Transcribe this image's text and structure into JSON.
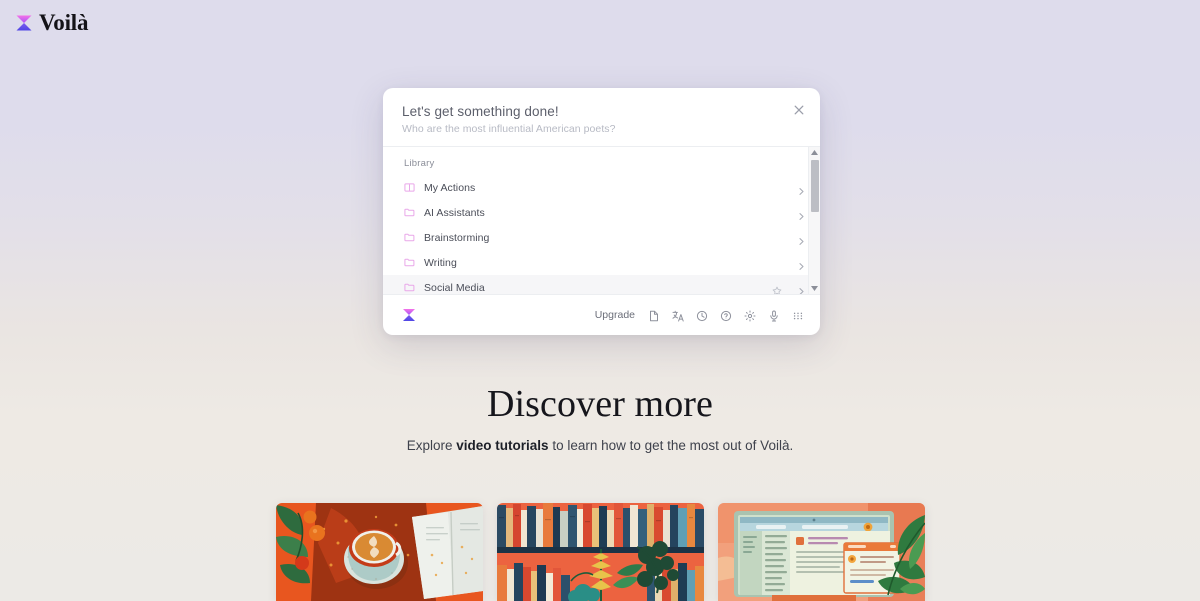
{
  "brand": {
    "name": "Voilà",
    "logo_icon": "hourglass-icon"
  },
  "modal": {
    "title": "Let's get something done!",
    "search_placeholder": "Who are the most influential American poets?",
    "close_icon": "close-icon",
    "section_label": "Library",
    "items": [
      {
        "label": "My Actions",
        "icon": "book-icon",
        "chevron": "chevron-right-icon",
        "starred": false,
        "selected": false
      },
      {
        "label": "AI Assistants",
        "icon": "folder-icon",
        "chevron": "chevron-right-icon",
        "starred": false,
        "selected": false
      },
      {
        "label": "Brainstorming",
        "icon": "folder-icon",
        "chevron": "chevron-right-icon",
        "starred": false,
        "selected": false
      },
      {
        "label": "Writing",
        "icon": "folder-icon",
        "chevron": "chevron-right-icon",
        "starred": false,
        "selected": false
      },
      {
        "label": "Social Media",
        "icon": "folder-icon",
        "chevron": "chevron-right-icon",
        "starred": true,
        "selected": true
      }
    ],
    "scrollbar": {
      "up_icon": "scroll-up-arrow",
      "down_icon": "scroll-down-arrow"
    },
    "footer": {
      "logo_icon": "hourglass-icon",
      "upgrade_label": "Upgrade",
      "icons": [
        "document-icon",
        "translate-icon",
        "history-clock-icon",
        "help-circle-icon",
        "settings-gear-icon",
        "microphone-icon",
        "apps-grid-icon"
      ]
    }
  },
  "discover": {
    "heading": "Discover more",
    "body_prefix": "Explore ",
    "body_bold": "video tutorials",
    "body_suffix": " to learn how to get the most out of Voilà."
  },
  "cards": [
    {
      "name": "card-coffee-book",
      "alt": "Coffee cup with latte art beside an open book on an orange table"
    },
    {
      "name": "card-bookshelf",
      "alt": "Colorful bookshelf with plants against an orange wall"
    },
    {
      "name": "card-email-screen",
      "alt": "Computer monitor showing an email interface with leaves"
    }
  ],
  "colors": {
    "accent_pink": "#e9a7e9",
    "logo_top": "#f05ce0",
    "logo_bottom": "#5b4be8",
    "background_top": "#dedcec",
    "background_bottom": "#eceae6"
  }
}
